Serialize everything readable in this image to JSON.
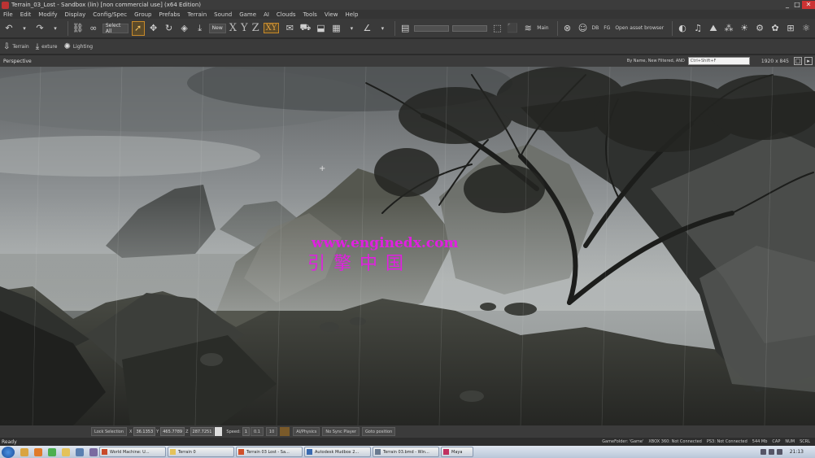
{
  "window": {
    "title": "Terrain_03_Lost - Sandbox (lin) [non commercial use] (x64 Edition)",
    "buttons": [
      "_",
      "□",
      "✕"
    ]
  },
  "menu": [
    "File",
    "Edit",
    "Modify",
    "Display",
    "Config/Spec",
    "Group",
    "Prefabs",
    "Terrain",
    "Sound",
    "Game",
    "AI",
    "Clouds",
    "Tools",
    "View",
    "Help"
  ],
  "toolbar": {
    "select_filter": "Select All",
    "layer_select": "New",
    "axes": [
      "X",
      "Y",
      "Z",
      "XY"
    ],
    "active_axis": "XY",
    "main_label": "Main",
    "db_label": "DB",
    "fg_label": "FG",
    "asset_browser": "Open asset browser"
  },
  "toolbar2": {
    "terrain": "Terrain",
    "texture": "exture",
    "lighting": "Lighting"
  },
  "viewport": {
    "title": "Perspective",
    "filter_text": "By Name, New Filtered, AND",
    "search_placeholder": "Ctrl+Shift+F",
    "resolution": "1920 x 845",
    "watermark_cn": "引擎中国",
    "watermark_url": "www.enginedx.com"
  },
  "statbar": {
    "lock_selection": "Lock Selection",
    "x_label": "X",
    "x_value": "36.1353",
    "y_label": "Y",
    "y_value": "465.7789",
    "z_label": "Z",
    "z_value": "287.7251",
    "speed_label": "Speed:",
    "speed_value": "1",
    "speed_step": "0.1",
    "speed_max": "10",
    "ai_physics": "AI/Physics",
    "no_sync_player": "No Sync Player",
    "goto_position": "Goto position"
  },
  "status": {
    "ready": "Ready",
    "game_folder": "GameFolder: 'Game'",
    "xbox": "XBOX 360: Not Connected",
    "ps3": "PS3: Not Connected",
    "memory": "544 Mb",
    "cap": "CAP",
    "num": "NUM",
    "scrl": "SCRL"
  },
  "taskbar": {
    "tasks": [
      "World Machine: U...",
      "Terrain 0",
      "Terrain 03 Lost - Sa...",
      "Autodesk Mudbox 2...",
      "Terrain 03.bmd - Win...",
      "Maya"
    ],
    "clock": "21:13"
  },
  "colors": {
    "accent": "#c88a2a",
    "watermark": "#e020e0"
  }
}
